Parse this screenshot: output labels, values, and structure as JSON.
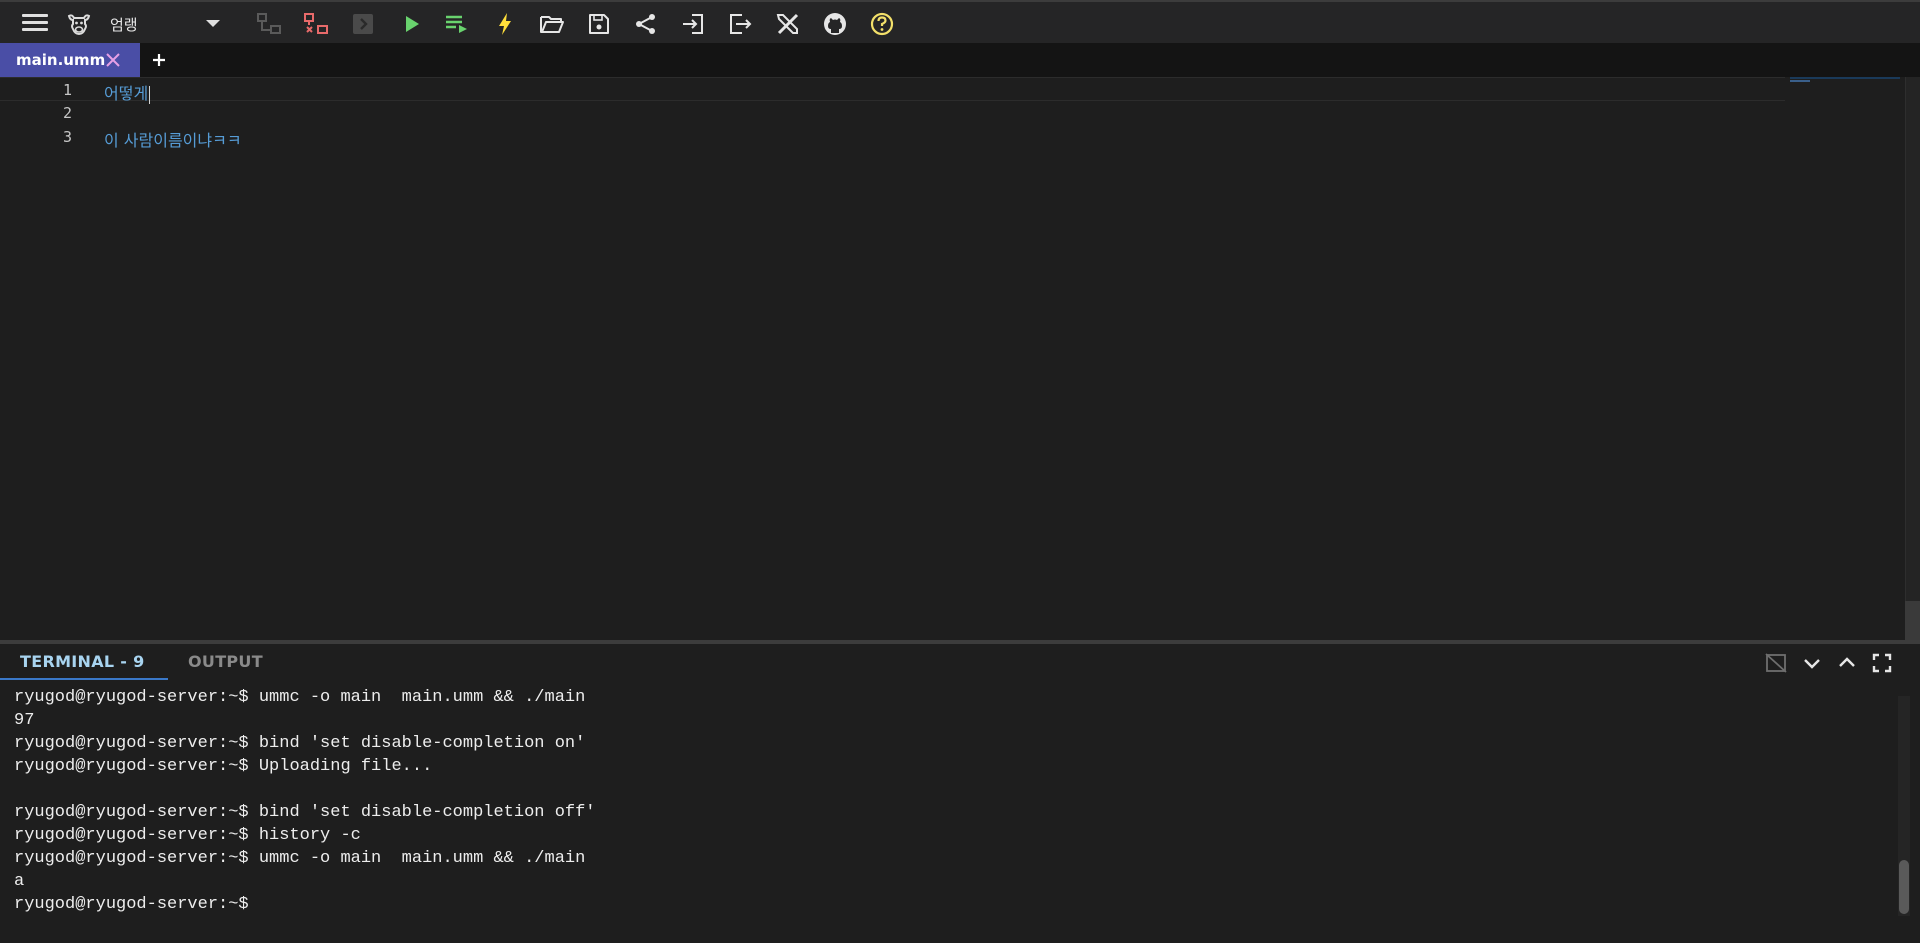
{
  "toolbar": {
    "language": "엄랭",
    "icons": [
      "connect-icon",
      "disconnect-icon",
      "terminal-icon",
      "run-icon",
      "run-input-icon",
      "flash-icon",
      "open-folder-icon",
      "save-icon",
      "share-icon",
      "import-icon",
      "export-icon",
      "tools-icon",
      "github-icon",
      "help-icon"
    ],
    "colors": {
      "run": "#69d36e",
      "disconnect": "#e86a6a",
      "flash": "#ffdf3b",
      "help": "#f3e06a"
    }
  },
  "tabs": {
    "active": "main.umm",
    "add": "+"
  },
  "editor": {
    "lines": [
      {
        "num": "1",
        "text": "어떻게"
      },
      {
        "num": "2",
        "text": ""
      },
      {
        "num": "3",
        "text": "이 사람이름이냐ㅋㅋ"
      }
    ]
  },
  "panel": {
    "terminal_tab": "TERMINAL - 9",
    "output_tab": "OUTPUT",
    "terminal_lines": [
      "ryugod@ryugod-server:~$ ummc -o main  main.umm && ./main",
      "97",
      "ryugod@ryugod-server:~$ bind 'set disable-completion on'",
      "ryugod@ryugod-server:~$ Uploading file...",
      "",
      "ryugod@ryugod-server:~$ bind 'set disable-completion off'",
      "ryugod@ryugod-server:~$ history -c",
      "ryugod@ryugod-server:~$ ummc -o main  main.umm && ./main",
      "a",
      "ryugod@ryugod-server:~$ "
    ]
  },
  "theme": {
    "accent": "#4a4ea6",
    "background": "#1e1e1e",
    "code": "#569cd6"
  }
}
